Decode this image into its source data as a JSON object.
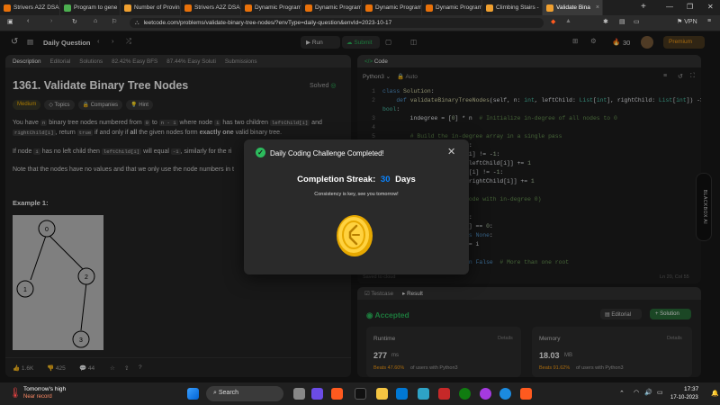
{
  "browser": {
    "tabs": [
      {
        "label": "Strivers A2Z DSA",
        "color": "#e8710a"
      },
      {
        "label": "Program to gene",
        "color": "#4caf50"
      },
      {
        "label": "Number of Provin",
        "color": "#f0a030"
      },
      {
        "label": "Strivers A2Z DSA",
        "color": "#e8710a"
      },
      {
        "label": "Dynamic Program",
        "color": "#e8710a"
      },
      {
        "label": "Dynamic Program",
        "color": "#e8710a"
      },
      {
        "label": "Dynamic Program",
        "color": "#e8710a"
      },
      {
        "label": "Dynamic Program",
        "color": "#e8710a"
      },
      {
        "label": "Climbing Stairs -",
        "color": "#f0a030"
      },
      {
        "label": "Validate Bina",
        "color": "#f0a030"
      }
    ],
    "new_tab": "+",
    "url": "leetcode.com/problems/validate-binary-tree-nodes/?envType=daily-question&envId=2023-10-17",
    "vpn": "VPN"
  },
  "header": {
    "daily_question": "Daily Question",
    "run": "Run",
    "submit": "Submit",
    "streak": "30",
    "premium": "Premium"
  },
  "left": {
    "tabs": [
      "Description",
      "Editorial",
      "Solutions",
      "82.42% Easy BFS",
      "87.44% Easy Soluti",
      "Submissions"
    ],
    "title": "1361. Validate Binary Tree Nodes",
    "solved": "Solved",
    "difficulty": "Medium",
    "topics": "Topics",
    "companies": "Companies",
    "hint": "Hint",
    "p1_a": "You have",
    "p1_n": "n",
    "p1_b": "binary tree nodes numbered from",
    "p1_0": "0",
    "p1_to": "to",
    "p1_n1": "n - 1",
    "p1_c": "where node",
    "p1_i": "i",
    "p1_d": "has two children",
    "p1_lc": "leftChild[i]",
    "p1_and": "and",
    "p1_rc": "rightChild[i]",
    "p1_e": ", return",
    "p1_true": "true",
    "p1_f": "if and only if",
    "p1_all": "all",
    "p1_g": "the given nodes form",
    "p1_one": "exactly one",
    "p1_h": "valid binary tree.",
    "p2_a": "If node",
    "p2_i": "i",
    "p2_b": "has no left child then",
    "p2_lc": "leftChild[i]",
    "p2_c": "will equal",
    "p2_m1": "-1",
    "p2_d": ", similarly for the ri",
    "p3": "Note that the nodes have no values and that we only use the node numbers in t",
    "example": "Example 1:",
    "tree_nodes": [
      "0",
      "1",
      "2",
      "3"
    ],
    "likes": "1.6K",
    "dislikes": "425",
    "comments": "44"
  },
  "code": {
    "tab": "Code",
    "lang": "Python3",
    "auto": "Auto",
    "lines": [
      {
        "n": "1",
        "t": "class Solution:"
      },
      {
        "n": "2",
        "t": "    def validateBinaryTreeNodes(self, n: int, leftChild: List[int], rightChild: List[int]) ->"
      },
      {
        "n": "",
        "t": "bool:"
      },
      {
        "n": "3",
        "t": "        indegree = [0] * n  # Initialize in-degree of all nodes to 0"
      },
      {
        "n": "4",
        "t": ""
      },
      {
        "n": "5",
        "t": "        # Build the in-degree array in a single pass"
      },
      {
        "n": "6",
        "t": "        for i in range(n):"
      },
      {
        "n": "7",
        "t": "            if leftChild[i] != -1:"
      },
      {
        "n": "8",
        "t": "                indegree[leftChild[i]] += 1"
      },
      {
        "n": "9",
        "t": "            if rightChild[i] != -1:"
      },
      {
        "n": "10",
        "t": "                indegree[rightChild[i]] += 1"
      },
      {
        "n": "11",
        "t": ""
      },
      {
        "n": "12",
        "t": "        # Find the root node with in-degree 0)"
      },
      {
        "n": "13",
        "t": "        root = None"
      },
      {
        "n": "14",
        "t": "        for i in range(n):"
      },
      {
        "n": "15",
        "t": "            if indegree[i] == 0:"
      },
      {
        "n": "16",
        "t": "                if root is None:"
      },
      {
        "n": "17",
        "t": "                    root = i"
      },
      {
        "n": "18",
        "t": "                else:"
      },
      {
        "n": "19",
        "t": "                    return False  # More than one root"
      }
    ],
    "saved": "Saved to cloud",
    "position": "Ln 20, Col 55"
  },
  "result": {
    "testcase_tab": "Testcase",
    "result_tab": "Result",
    "status": "Accepted",
    "editorial": "Editorial",
    "solution": "+ Solution",
    "runtime_label": "Runtime",
    "runtime_value": "277",
    "runtime_unit": "ms",
    "runtime_beats": "Beats 47.60%",
    "runtime_suffix": "of users with Python3",
    "memory_label": "Memory",
    "memory_value": "18.03",
    "memory_unit": "MB",
    "memory_beats": "Beats 91.62%",
    "memory_suffix": "of users with Python3",
    "details": "Details"
  },
  "modal": {
    "title": "Daily Coding Challenge Completed!",
    "streak_label": "Completion Streak:",
    "streak_value": "30",
    "streak_unit": "Days",
    "subtitle": "Consistency is key, see you tomorrow!"
  },
  "side_badge": "BLACKBOX AI",
  "taskbar": {
    "weather_title": "Tomorrow's high",
    "weather_sub": "Near record",
    "search": "Search",
    "lang": "ENG\nIN",
    "time": "17:37",
    "date": "17-10-2023"
  },
  "colors": {
    "accent": "#ffa116",
    "green": "#2cbb5d",
    "blue": "#0a84ff"
  }
}
